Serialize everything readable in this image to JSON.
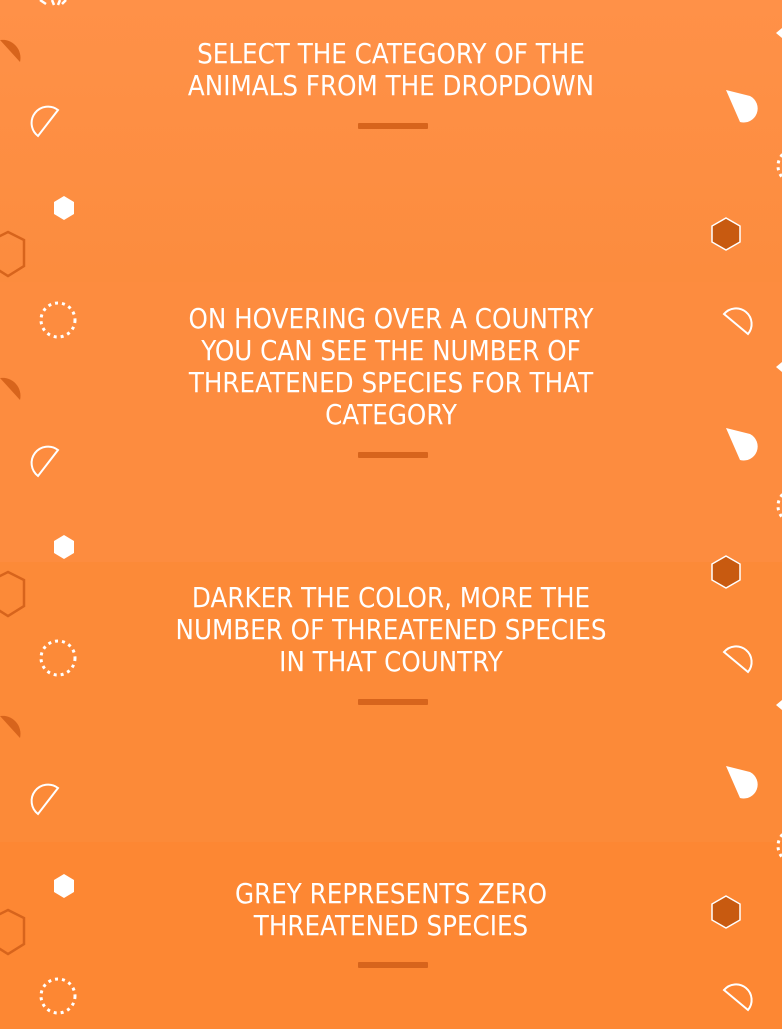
{
  "steps": [
    {
      "text": "SELECT THE CATEGORY OF THE ANIMALS FROM THE DROPDOWN"
    },
    {
      "text": "ON HOVERING OVER A COUNTRY YOU CAN SEE THE NUMBER OF THREATENED SPECIES FOR THAT CATEGORY"
    },
    {
      "text": "DARKER THE COLOR, MORE THE NUMBER OF THREATENED SPECIES IN THAT COUNTRY"
    },
    {
      "text": "GREY REPRESENTS ZERO THREATENED SPECIES"
    }
  ],
  "colors": {
    "background": "#fb8a3c",
    "divider": "#d7641c",
    "text": "#ffffff"
  },
  "icons": [
    "hexagon-icon",
    "hexagon-outline-icon",
    "half-circle-icon",
    "half-circle-outline-icon",
    "dashed-circle-icon"
  ]
}
